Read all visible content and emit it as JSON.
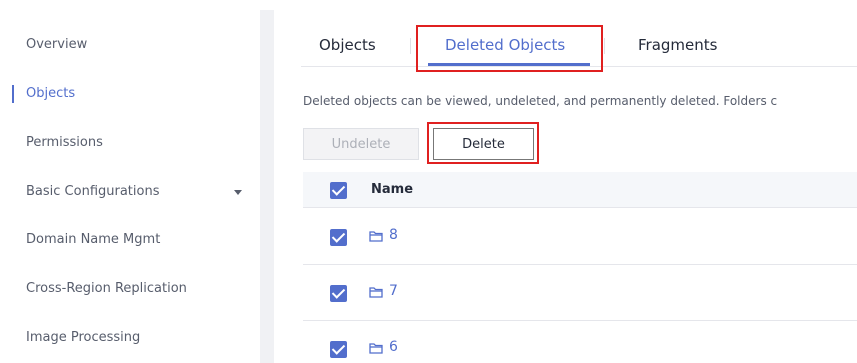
{
  "sidebar": {
    "items": [
      {
        "label": "Overview"
      },
      {
        "label": "Objects"
      },
      {
        "label": "Permissions"
      },
      {
        "label": "Basic Configurations"
      },
      {
        "label": "Domain Name Mgmt"
      },
      {
        "label": "Cross-Region Replication"
      },
      {
        "label": "Image Processing"
      }
    ],
    "active": "Objects"
  },
  "tabs": [
    {
      "label": "Objects"
    },
    {
      "label": "Deleted Objects"
    },
    {
      "label": "Fragments"
    }
  ],
  "active_tab": "Deleted Objects",
  "info_text": "Deleted objects can be viewed, undeleted, and permanently deleted. Folders c",
  "buttons": {
    "undelete": "Undelete",
    "delete": "Delete"
  },
  "table": {
    "header_name": "Name",
    "rows": [
      {
        "name": "8"
      },
      {
        "name": "7"
      },
      {
        "name": "6"
      }
    ]
  },
  "colors": {
    "accent": "#526ecc",
    "highlight": "#e02020"
  }
}
